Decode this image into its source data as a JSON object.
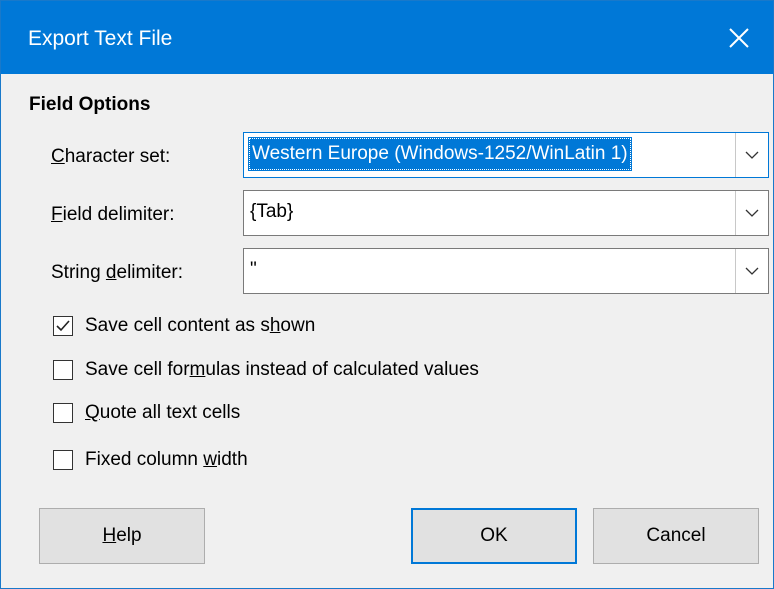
{
  "window": {
    "title": "Export Text File"
  },
  "field_options": {
    "heading": "Field Options",
    "character_set": {
      "label": "Character set:",
      "value": "Western Europe (Windows-1252/WinLatin 1)"
    },
    "field_delimiter": {
      "label": "Field delimiter:",
      "value": "{Tab}"
    },
    "string_delimiter": {
      "label": "String delimiter:",
      "value": "\""
    }
  },
  "options": [
    {
      "label": "Save cell content as shown",
      "checked": true
    },
    {
      "label": "Save cell formulas instead of calculated values",
      "checked": false
    },
    {
      "label": "Quote all text cells",
      "checked": false
    },
    {
      "label": "Fixed column width",
      "checked": false
    }
  ],
  "buttons": {
    "help": "Help",
    "ok": "OK",
    "cancel": "Cancel"
  },
  "icons": {
    "close": "close-icon",
    "dropdown": "chevron-down-icon",
    "check": "checkmark-icon"
  },
  "colors": {
    "accent": "#0078d7",
    "titlebar_text": "#ffffff",
    "dialog_bg": "#f0f0f0"
  }
}
